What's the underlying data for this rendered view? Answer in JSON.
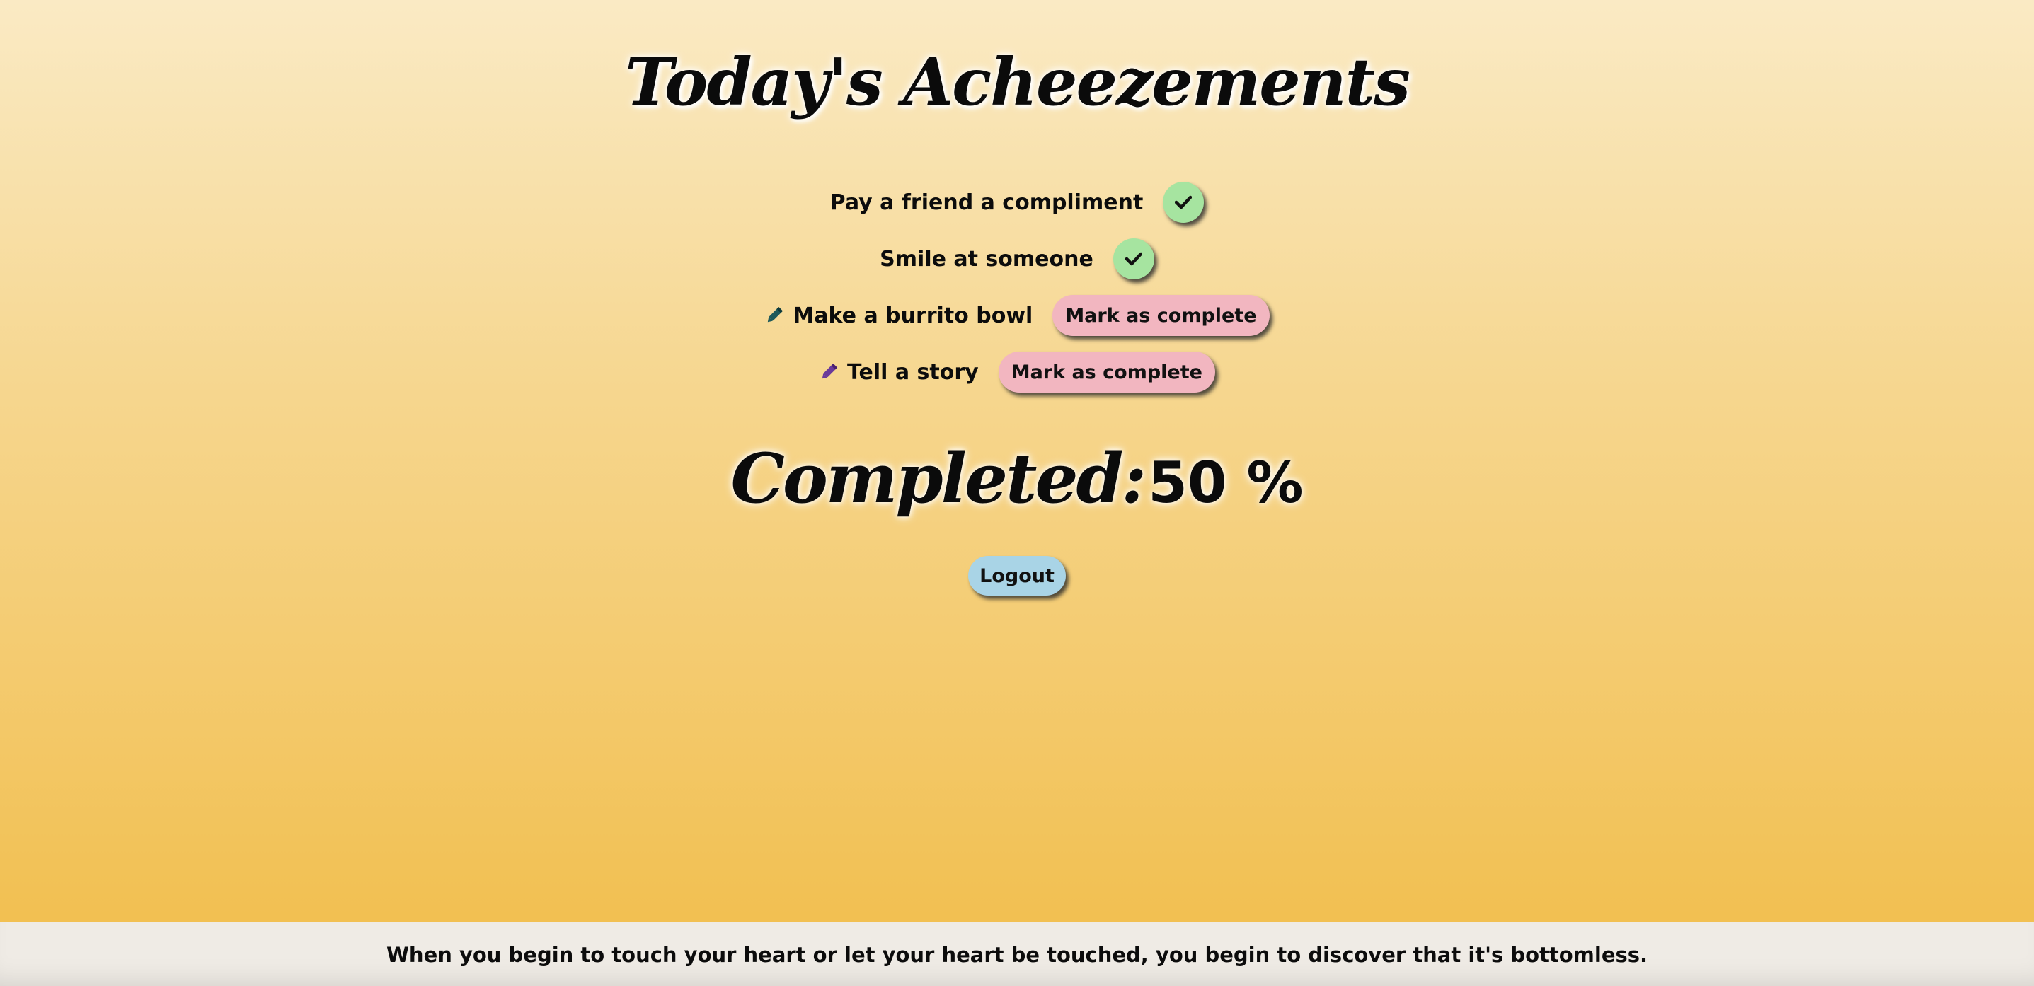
{
  "title": "Today's Acheezements",
  "tasks": [
    {
      "label": "Pay a friend a compliment",
      "status": "complete",
      "icon": "check-icon",
      "pencil_color": ""
    },
    {
      "label": "Smile at someone",
      "status": "complete",
      "icon": "check-icon",
      "pencil_color": ""
    },
    {
      "label": "Make a burrito bowl",
      "status": "incomplete",
      "button_label": "Mark as complete",
      "icon": "pencil-icon",
      "pencil_color": "#1f5a5a"
    },
    {
      "label": "Tell a story",
      "status": "incomplete",
      "button_label": "Mark as complete",
      "icon": "pencil-icon",
      "pencil_color": "#6a3a9a"
    }
  ],
  "progress": {
    "label": "Completed:",
    "value": "50 %",
    "percent": 50
  },
  "logout_label": "Logout",
  "footer": {
    "quote": "When you begin to touch your heart or let your heart be touched, you begin to discover that it's bottomless."
  },
  "colors": {
    "complete_button": "#a6e4a0",
    "mark_button": "#f2b6c0",
    "logout_button": "#a9d4e6",
    "background_top": "#faeac4",
    "background_bottom": "#f1bd4a",
    "footer_background": "#efebe5"
  }
}
